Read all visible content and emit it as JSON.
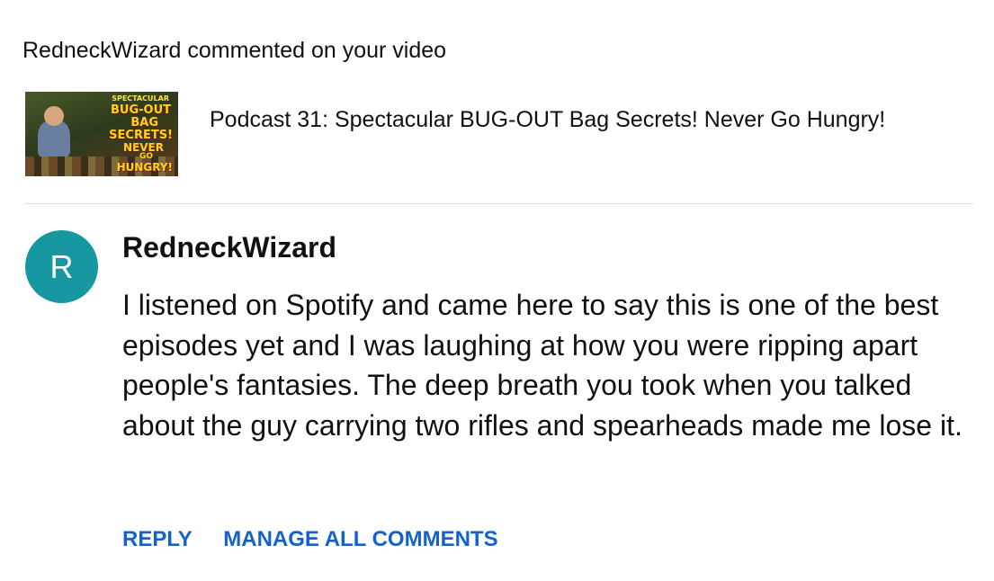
{
  "notification": {
    "header": "RedneckWizard commented on your video"
  },
  "video": {
    "title": "Podcast 31: Spectacular BUG-OUT Bag Secrets! Never Go Hungry!",
    "thumbnail_text": [
      "SPECTACULAR",
      "BUG-OUT",
      "BAG",
      "SECRETS!",
      "NEVER",
      "GO",
      "HUNGRY!"
    ]
  },
  "comment": {
    "avatar_letter": "R",
    "avatar_color": "#1798a0",
    "author": "RedneckWizard",
    "text": "I listened on Spotify and came here to say this is one of the best episodes yet and I was laughing at how you were ripping apart people's fantasies. The deep breath you took when you talked about the guy carrying two rifles and spearheads made me lose it."
  },
  "actions": {
    "reply_label": "REPLY",
    "manage_label": "MANAGE ALL COMMENTS",
    "link_color": "#1463cc"
  }
}
